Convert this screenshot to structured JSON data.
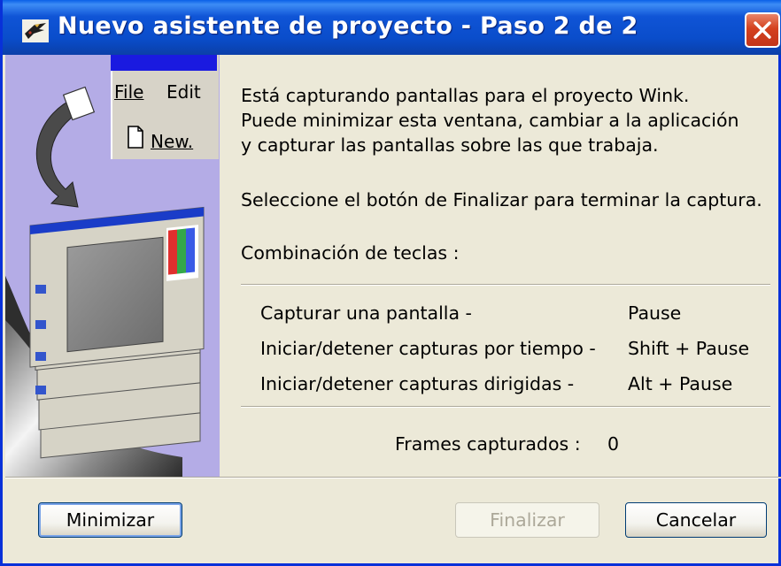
{
  "window": {
    "title": "Nuevo asistente de proyecto - Paso 2 de 2",
    "icons": {
      "app": "wink-bird-icon",
      "close": "close-icon"
    }
  },
  "banner": {
    "menu": {
      "file": "File",
      "edit": "Edit",
      "new": "New."
    }
  },
  "content": {
    "line1": "Está capturando pantallas para el proyecto Wink.",
    "line2": "Puede minimizar esta ventana, cambiar a la aplicación",
    "line3": "y capturar las pantallas sobre las que trabaja.",
    "finish_hint": "Seleccione el botón de Finalizar para terminar la captura.",
    "hotkeys_title": "Combinación de teclas :",
    "hotkeys": [
      {
        "label": "Capturar una pantalla -",
        "key": "Pause"
      },
      {
        "label": "Iniciar/detener capturas por tiempo -",
        "key": "Shift + Pause"
      },
      {
        "label": "Iniciar/detener capturas dirigidas -",
        "key": "Alt + Pause"
      }
    ],
    "frames_label": "Frames capturados :",
    "frames_value": "0"
  },
  "buttons": {
    "minimize": "Minimizar",
    "finish": "Finalizar",
    "cancel": "Cancelar"
  },
  "colors": {
    "titlebar": "#0A4DCB",
    "dialog_bg": "#ECE9D8",
    "banner_bg": "#B4ACE6",
    "close_red": "#D4411E"
  }
}
